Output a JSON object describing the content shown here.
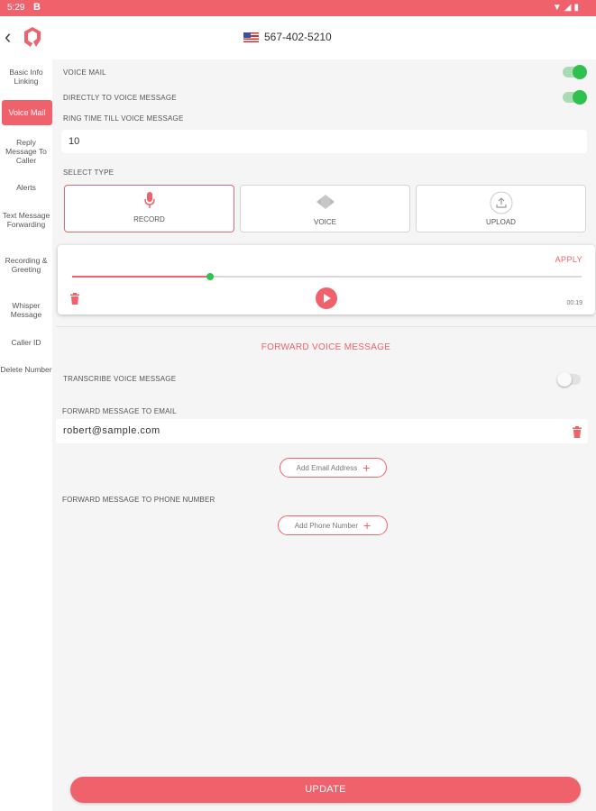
{
  "status_bar": {
    "time": "5:29",
    "app_glyph": "B",
    "icons": [
      "wifi-icon",
      "signal-icon",
      "battery-icon"
    ]
  },
  "header": {
    "phone_number": "567-402-5210",
    "flag": "us-flag"
  },
  "sidebar": {
    "items": [
      {
        "label": "Basic Info Linking",
        "active": false
      },
      {
        "label": "Voice Mail",
        "active": true
      },
      {
        "label": "Reply Message To Caller",
        "active": false
      },
      {
        "label": "Alerts",
        "active": false
      },
      {
        "label": "Text Message Forwarding",
        "active": false
      },
      {
        "label": "Recording & Greeting",
        "active": false
      },
      {
        "label": "Whisper Message",
        "active": false
      },
      {
        "label": "Caller ID",
        "active": false
      },
      {
        "label": "Delete Number",
        "active": false
      }
    ]
  },
  "voicemail": {
    "voice_mail_label": "VOICE MAIL",
    "voice_mail_on": true,
    "direct_label": "DIRECTLY TO VOICE MESSAGE",
    "direct_on": true,
    "ring_time_label": "RING TIME TILL VOICE MESSAGE",
    "ring_time_value": "10",
    "select_type_label": "SELECT TYPE",
    "types": [
      {
        "label": "RECORD",
        "icon": "microphone-icon",
        "selected": true
      },
      {
        "label": "VOICE",
        "icon": "voice-icon",
        "selected": false
      },
      {
        "label": "UPLOAD",
        "icon": "upload-icon",
        "selected": false
      }
    ]
  },
  "player": {
    "apply_label": "APPLY",
    "progress_fraction": 0.27,
    "duration": "00:19"
  },
  "forward": {
    "section_title": "FORWARD VOICE MESSAGE",
    "transcribe_label": "TRANSCRIBE VOICE MESSAGE",
    "transcribe_on": false,
    "email_label": "FORWARD MESSAGE TO EMAIL",
    "email_value": "robert@sample.com",
    "add_email_label": "Add Email Address",
    "phone_label": "FORWARD MESSAGE TO PHONE NUMBER",
    "add_phone_label": "Add Phone Number"
  },
  "update_label": "UPDATE",
  "colors": {
    "accent": "#f0626b",
    "toggle_on": "#2ec14e",
    "background": "#f5f5f5"
  }
}
